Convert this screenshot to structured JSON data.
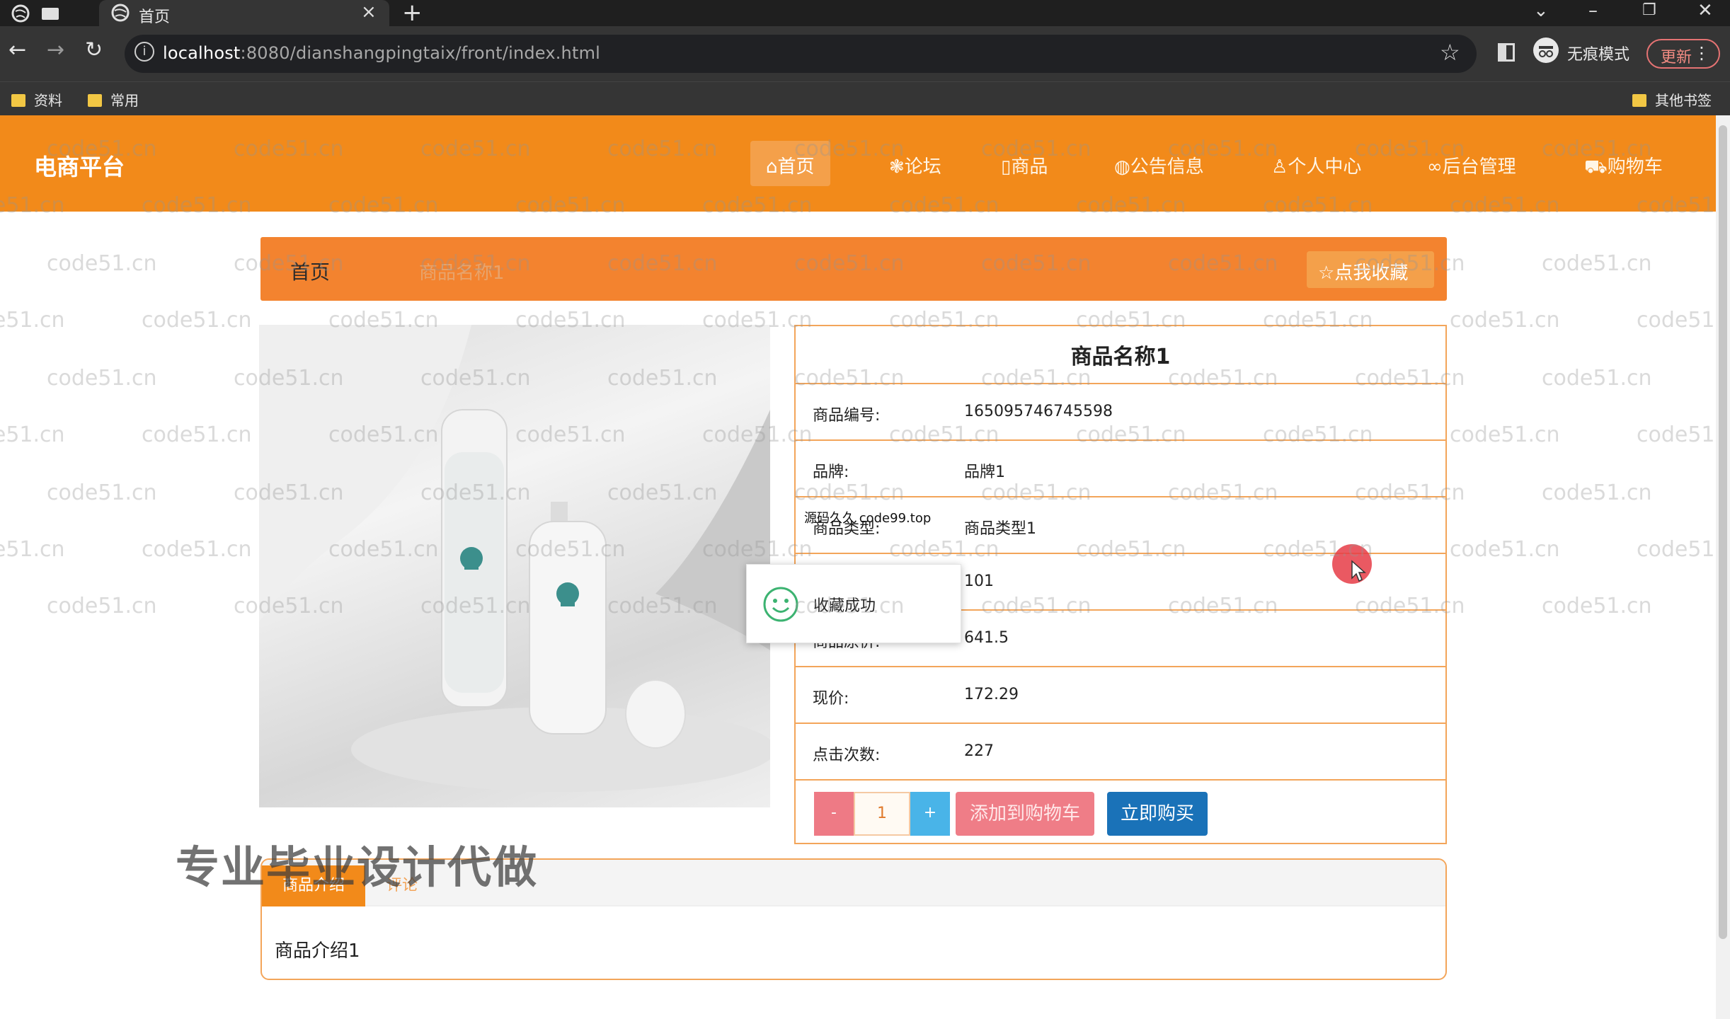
{
  "browser": {
    "tab_title": "首页",
    "url_host": "localhost",
    "url_rest": ":8080/dianshangpingtaix/front/index.html",
    "incognito_label": "无痕模式",
    "update_label": "更新",
    "bookmarks": [
      "资料",
      "常用"
    ],
    "other_bookmarks": "其他书签"
  },
  "site": {
    "logo": "电商平台",
    "nav": [
      "首页",
      "论坛",
      "商品",
      "公告信息",
      "个人中心",
      "后台管理",
      "购物车"
    ]
  },
  "breadcrumb": {
    "home": "首页",
    "current": "商品名称1"
  },
  "favorite_button": "点我收藏",
  "product": {
    "title": "商品名称1",
    "rows": [
      {
        "label": "商品编号:",
        "value": "165095746745598"
      },
      {
        "label": "品牌:",
        "value": "品牌1"
      },
      {
        "label": "商品类型:",
        "value": "商品类型1"
      },
      {
        "label": "",
        "value": "101"
      },
      {
        "label": "商品原价:",
        "value": "641.5"
      },
      {
        "label": "现价:",
        "value": "172.29"
      },
      {
        "label": "点击次数:",
        "value": "227"
      }
    ],
    "qty_minus": "-",
    "qty_value": "1",
    "qty_plus": "+",
    "add_to_cart": "添加到购物车",
    "buy_now": "立即购买"
  },
  "tabs": {
    "intro": "商品介绍",
    "review": "评论",
    "intro_text": "商品介绍1"
  },
  "toast": {
    "text": "收藏成功"
  },
  "overlays": {
    "source": "源码久久 code99.top",
    "promo": "专业毕业设计代做",
    "watermark": "code51.cn"
  },
  "colors": {
    "header": "#f28a1a",
    "breadcrumb": "#f3832f",
    "border": "#f3a55a",
    "buy": "#1a72b8",
    "cart": "#ef7d87"
  }
}
